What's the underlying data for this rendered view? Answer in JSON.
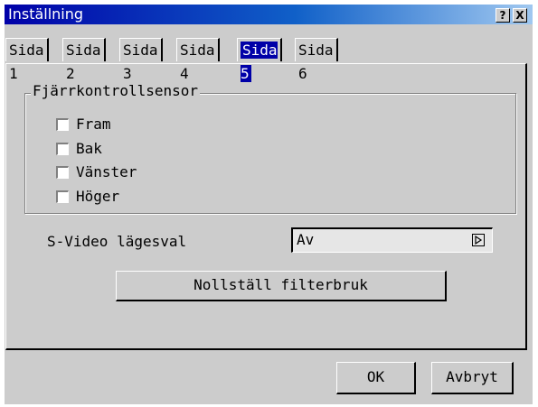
{
  "window": {
    "title": "Inställning",
    "help_button": "?",
    "close_button": "X"
  },
  "tabs": [
    {
      "label": "Sida 1"
    },
    {
      "label": "Sida 2"
    },
    {
      "label": "Sida 3"
    },
    {
      "label": "Sida 4"
    },
    {
      "label": "Sida 5",
      "active": true
    },
    {
      "label": "Sida 6"
    }
  ],
  "remote_sensor": {
    "title": "Fjärrkontrollsensor",
    "options": [
      {
        "label": "Fram",
        "checked": false
      },
      {
        "label": "Bak",
        "checked": false
      },
      {
        "label": "Vänster",
        "checked": false
      },
      {
        "label": "Höger",
        "checked": false
      }
    ]
  },
  "svideo": {
    "label": "S-Video lägesval",
    "value": "Av"
  },
  "reset_filter_button": "Nollställ filterbruk",
  "footer": {
    "ok_label": "OK",
    "cancel_label": "Avbryt"
  }
}
